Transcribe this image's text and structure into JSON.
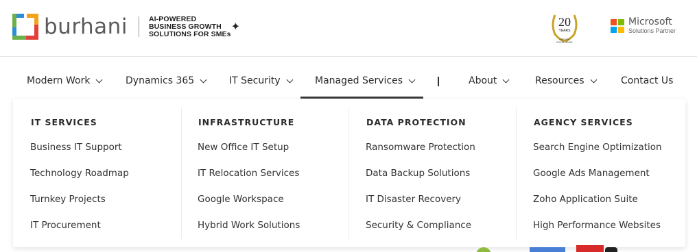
{
  "header": {
    "logo_text": "burhani",
    "tagline": [
      "AI-POWERED",
      "BUSINESS GROWTH",
      "SOLUTIONS FOR SMEs"
    ],
    "badge": {
      "number": "20",
      "years": "YEARS",
      "caption_line1": "SERVICE",
      "caption_line2": "EXCELLENCE"
    },
    "partner": {
      "name": "Microsoft",
      "sub": "Solutions Partner"
    },
    "colors": {
      "logo_green": "#6ab04c",
      "logo_blue": "#2d8ed8",
      "logo_red": "#e2403a",
      "logo_orange": "#f4a21a",
      "gold": "#c9a227"
    }
  },
  "nav": {
    "items": [
      {
        "label": "Modern Work",
        "has_dropdown": true
      },
      {
        "label": "Dynamics 365",
        "has_dropdown": true
      },
      {
        "label": "IT Security",
        "has_dropdown": true
      },
      {
        "label": "Managed Services",
        "has_dropdown": true,
        "active": true
      },
      {
        "label": "About",
        "has_dropdown": true
      },
      {
        "label": "Resources",
        "has_dropdown": true
      },
      {
        "label": "Contact Us",
        "has_dropdown": false
      }
    ],
    "separator": "|"
  },
  "mega_menu": {
    "columns": [
      {
        "heading": "IT SERVICES",
        "links": [
          "Business IT Support",
          "Technology Roadmap",
          "Turnkey Projects",
          "IT Procurement"
        ]
      },
      {
        "heading": "INFRASTRUCTURE",
        "links": [
          "New Office IT Setup",
          "IT Relocation Services",
          "Google Workspace",
          "Hybrid Work Solutions"
        ]
      },
      {
        "heading": "DATA PROTECTION",
        "links": [
          "Ransomware Protection",
          "Data Backup Solutions",
          "IT Disaster Recovery",
          "Security & Compliance"
        ]
      },
      {
        "heading": "AGENCY SERVICES",
        "links": [
          "Search Engine Optimization",
          "Google Ads Management",
          "Zoho Application Suite",
          "High Performance Websites"
        ]
      }
    ]
  }
}
